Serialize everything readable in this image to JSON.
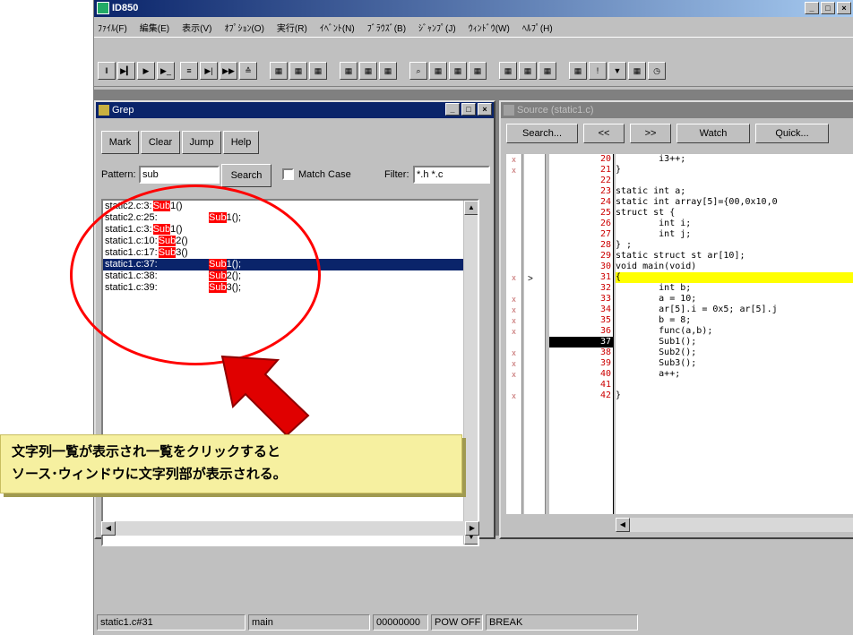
{
  "app": {
    "title": "ID850",
    "controls": {
      "minimize": "_",
      "maximize": "□",
      "close": "×"
    }
  },
  "menu": [
    "ﾌｧｲﾙ(F)",
    "編集(E)",
    "表示(V)",
    "ｵﾌﾟｼｮﾝ(O)",
    "実行(R)",
    "ｲﾍﾞﾝﾄ(N)",
    "ﾌﾞﾗｳｽﾞ(B)",
    "ｼﾞｬﾝﾌﾟ(J)",
    "ｳｨﾝﾄﾞｳ(W)",
    "ﾍﾙﾌﾟ(H)"
  ],
  "grep": {
    "title": "Grep",
    "buttons": {
      "mark": "Mark",
      "clear": "Clear",
      "jump": "Jump",
      "help": "Help",
      "search": "Search"
    },
    "pattern_label": "Pattern:",
    "pattern_value": "sub",
    "match_case_label": "Match Case",
    "filter_label": "Filter:",
    "filter_value": "*.h *.c",
    "results": [
      {
        "file": "static2.c:3:",
        "match": "Sub",
        "rest": "1()",
        "indent": false,
        "selected": false
      },
      {
        "file": "static2.c:25:",
        "match": "Sub",
        "rest": "1();",
        "indent": true,
        "selected": false
      },
      {
        "file": "static1.c:3:",
        "match": "Sub",
        "rest": "1()",
        "indent": false,
        "selected": false
      },
      {
        "file": "static1.c:10:",
        "match": "Sub",
        "rest": "2()",
        "indent": false,
        "selected": false
      },
      {
        "file": "static1.c:17:",
        "match": "Sub",
        "rest": "3()",
        "indent": false,
        "selected": false
      },
      {
        "file": "static1.c:37:",
        "match": "Sub",
        "rest": "1();",
        "indent": true,
        "selected": true
      },
      {
        "file": "static1.c:38:",
        "match": "Sub",
        "rest": "2();",
        "indent": true,
        "selected": false
      },
      {
        "file": "static1.c:39:",
        "match": "Sub",
        "rest": "3();",
        "indent": true,
        "selected": false
      }
    ]
  },
  "source": {
    "title": "Source (static1.c)",
    "buttons": {
      "search": "Search...",
      "prev": "<<",
      "next": ">>",
      "watch": "Watch",
      "quick": "Quick..."
    },
    "lines": [
      {
        "num": "20",
        "code": "        i3++;",
        "bp": "x",
        "cur": false,
        "yellow": false
      },
      {
        "num": "21",
        "code": "}",
        "bp": "x",
        "cur": false,
        "yellow": false
      },
      {
        "num": "22",
        "code": "",
        "bp": "",
        "cur": false,
        "yellow": false
      },
      {
        "num": "23",
        "code": "static int a;",
        "bp": "",
        "cur": false,
        "yellow": false
      },
      {
        "num": "24",
        "code": "static int array[5]={00,0x10,0",
        "bp": "",
        "cur": false,
        "yellow": false
      },
      {
        "num": "25",
        "code": "struct st {",
        "bp": "",
        "cur": false,
        "yellow": false
      },
      {
        "num": "26",
        "code": "        int i;",
        "bp": "",
        "cur": false,
        "yellow": false
      },
      {
        "num": "27",
        "code": "        int j;",
        "bp": "",
        "cur": false,
        "yellow": false
      },
      {
        "num": "28",
        "code": "} ;",
        "bp": "",
        "cur": false,
        "yellow": false
      },
      {
        "num": "29",
        "code": "static struct st ar[10];",
        "bp": "",
        "cur": false,
        "yellow": false
      },
      {
        "num": "30",
        "code": "void main(void)",
        "bp": "",
        "cur": false,
        "yellow": false
      },
      {
        "num": "31",
        "code": "{",
        "bp": "x",
        "cur": false,
        "yellow": true
      },
      {
        "num": "32",
        "code": "        int b;",
        "bp": "",
        "cur": false,
        "yellow": false
      },
      {
        "num": "33",
        "code": "        a = 10;",
        "bp": "x",
        "cur": false,
        "yellow": false
      },
      {
        "num": "34",
        "code": "        ar[5].i = 0x5; ar[5].j",
        "bp": "x",
        "cur": false,
        "yellow": false
      },
      {
        "num": "35",
        "code": "        b = 8;",
        "bp": "x",
        "cur": false,
        "yellow": false
      },
      {
        "num": "36",
        "code": "        func(a,b);",
        "bp": "x",
        "cur": false,
        "yellow": false
      },
      {
        "num": "37",
        "code": "        Sub1();",
        "bp": "",
        "cur": true,
        "yellow": false
      },
      {
        "num": "38",
        "code": "        Sub2();",
        "bp": "x",
        "cur": false,
        "yellow": false
      },
      {
        "num": "39",
        "code": "        Sub3();",
        "bp": "x",
        "cur": false,
        "yellow": false
      },
      {
        "num": "40",
        "code": "        a++;",
        "bp": "x",
        "cur": false,
        "yellow": false
      },
      {
        "num": "41",
        "code": "",
        "bp": "",
        "cur": false,
        "yellow": false
      },
      {
        "num": "42",
        "code": "}",
        "bp": "x",
        "cur": false,
        "yellow": false
      }
    ]
  },
  "callout": {
    "line1": "文字列一覧が表示され一覧をクリックすると",
    "line2": "ソース･ウィンドウに文字列部が表示される。"
  },
  "status": [
    "static1.c#31",
    "main",
    "00000000",
    "POW OFF",
    "BREAK"
  ],
  "colors": {
    "highlight": "#ff0000",
    "selection": "#0a246a",
    "pc_line": "#ffff00",
    "callout_bg": "#f6f0a0"
  }
}
